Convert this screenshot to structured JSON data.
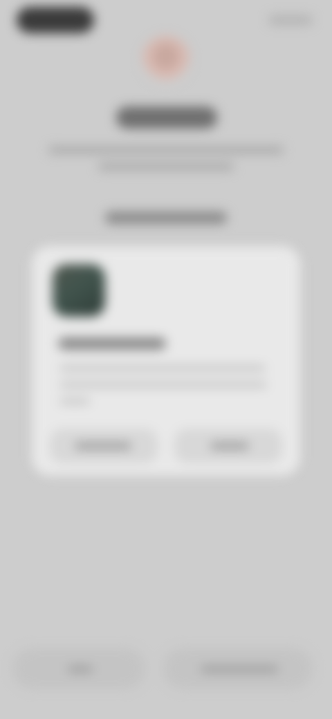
{
  "screen": {
    "background_color": "#cdcdcd",
    "card_color": "#e9e9e9",
    "accent_icon_color": "#41544d"
  }
}
